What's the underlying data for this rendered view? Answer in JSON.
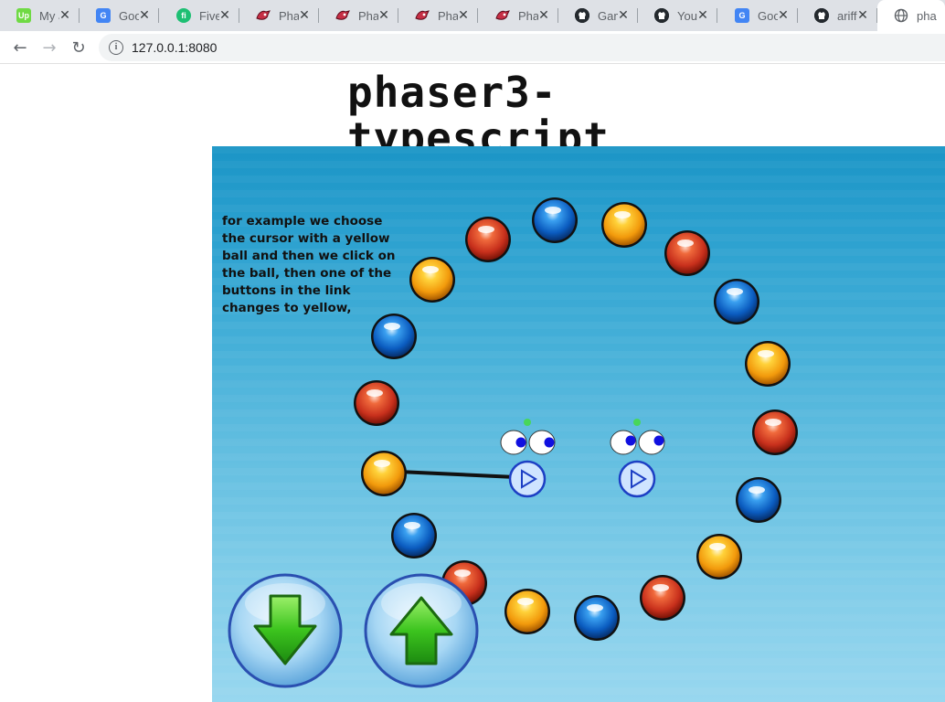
{
  "browser": {
    "tabs": [
      {
        "label": "My J",
        "favicon": "upwork-icon",
        "favicon_text": "Up"
      },
      {
        "label": "Goo",
        "favicon": "google-translate-icon",
        "favicon_text": "G"
      },
      {
        "label": "Fiver",
        "favicon": "fiverr-icon",
        "favicon_text": "fi"
      },
      {
        "label": "Phas",
        "favicon": "phaser-icon",
        "favicon_text": ""
      },
      {
        "label": "Phas",
        "favicon": "phaser-icon",
        "favicon_text": ""
      },
      {
        "label": "Phas",
        "favicon": "phaser-icon",
        "favicon_text": ""
      },
      {
        "label": "Phas",
        "favicon": "phaser-icon",
        "favicon_text": ""
      },
      {
        "label": "Gam",
        "favicon": "github-icon",
        "favicon_text": ""
      },
      {
        "label": "Your",
        "favicon": "github-icon",
        "favicon_text": ""
      },
      {
        "label": "Goo",
        "favicon": "google-translate-icon",
        "favicon_text": "G"
      },
      {
        "label": "ariff",
        "favicon": "github-icon",
        "favicon_text": ""
      },
      {
        "label": "phas",
        "favicon": "globe-icon",
        "favicon_text": "",
        "active": true
      }
    ],
    "url": "127.0.0.1:8080"
  },
  "page": {
    "title": "phaser3-typescript"
  },
  "game": {
    "instruction_text": "for example we choose the cursor with a yellow ball and then we click on the ball, then one of the buttons in the link changes to yellow,",
    "colors": {
      "red": "#d8402a",
      "blue": "#1a72d0",
      "yellow": "#f6a812",
      "arrow_green": "#3cc41e"
    },
    "balls": [
      {
        "color": "red"
      },
      {
        "color": "blue"
      },
      {
        "color": "yellow"
      },
      {
        "color": "red"
      },
      {
        "color": "blue"
      },
      {
        "color": "yellow"
      },
      {
        "color": "red"
      },
      {
        "color": "blue"
      },
      {
        "color": "yellow"
      },
      {
        "color": "red"
      },
      {
        "color": "blue"
      },
      {
        "color": "yellow"
      },
      {
        "color": "red"
      },
      {
        "color": "blue"
      },
      {
        "color": "yellow"
      },
      {
        "color": "red"
      },
      {
        "color": "blue"
      },
      {
        "color": "yellow"
      },
      {
        "color": "red"
      },
      {
        "color": "blue"
      }
    ],
    "creatures": [
      {
        "name": "left-creature"
      },
      {
        "name": "right-creature"
      }
    ],
    "buttons": {
      "down": "down-arrow-button",
      "up": "up-arrow-button"
    }
  }
}
